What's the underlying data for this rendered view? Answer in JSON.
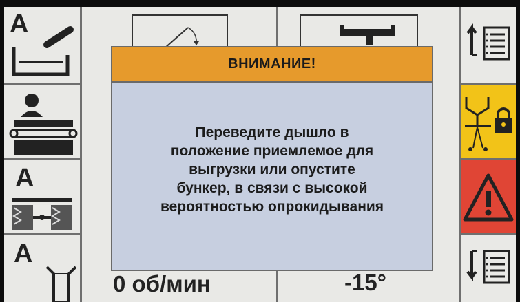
{
  "colors": {
    "dialog_header": "#e69a2c",
    "dialog_body": "#c7cfe0",
    "warning_tile": "#e04535",
    "lock_tile": "#f2c318",
    "screen_bg": "#e9e9e6"
  },
  "left_panel": {
    "items": [
      {
        "badge": "A",
        "icon": "auger-arm-icon"
      },
      {
        "badge": "",
        "icon": "operator-seat-icon"
      },
      {
        "badge": "A",
        "icon": "axle-track-icon"
      },
      {
        "badge": "A",
        "icon": "wheel-steer-icon"
      }
    ]
  },
  "top_panel": {
    "items": [
      {
        "icon": "drawbar-angle-icon"
      },
      {
        "icon": "hitch-icon"
      }
    ]
  },
  "right_panel": {
    "items": [
      {
        "icon": "menu-up-list-icon"
      },
      {
        "icon": "bunker-lock-icon"
      },
      {
        "icon": "warning-icon"
      },
      {
        "icon": "menu-down-list-icon"
      }
    ]
  },
  "dialog": {
    "title": "ВНИМАНИЕ!",
    "message_lines": [
      "Переведите дышло в",
      "положение приемлемое для",
      "выгрузки или опустите",
      "бункер, в связи с высокой",
      "вероятностью опрокидывания"
    ]
  },
  "status_bar": {
    "speed": "0 об/мин",
    "angle": "-15°"
  }
}
